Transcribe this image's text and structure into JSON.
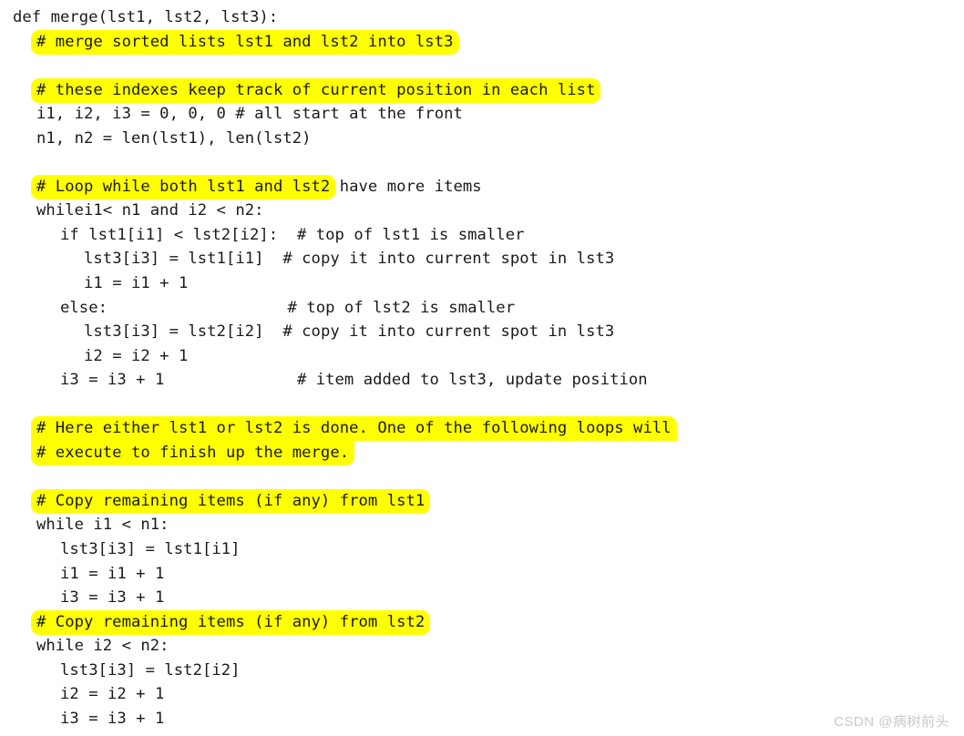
{
  "document": {
    "kind": "python-code-listing",
    "language": "Python",
    "background_color": "#ffffff",
    "text_color": "#1a1a1a",
    "highlight_color": "#ffff00"
  },
  "code": {
    "lines": [
      {
        "id": "l01",
        "indent": 0,
        "segments": [
          {
            "text": "def merge(lst1, lst2, lst3):",
            "highlight": "none"
          }
        ]
      },
      {
        "id": "l02",
        "indent": 1,
        "segments": [
          {
            "text": "# merge sorted lists lst1 and lst2 into lst3",
            "highlight": "full"
          }
        ]
      },
      {
        "id": "l03",
        "indent": 0,
        "blank": true,
        "segments": []
      },
      {
        "id": "l04",
        "indent": 1,
        "segments": [
          {
            "text": "# these indexes keep track of current position in each list",
            "highlight": "full"
          }
        ]
      },
      {
        "id": "l05",
        "indent": 1,
        "segments": [
          {
            "text": "i1, i2, i3 = 0, 0, 0 # all start at the front",
            "highlight": "none"
          }
        ]
      },
      {
        "id": "l06",
        "indent": 1,
        "segments": [
          {
            "text": "n1, n2 = len(lst1), len(lst2)",
            "highlight": "none"
          }
        ]
      },
      {
        "id": "l07",
        "indent": 0,
        "blank": true,
        "segments": []
      },
      {
        "id": "l08",
        "indent": 1,
        "segments": [
          {
            "text": "# Loop while both lst1 and lst2",
            "highlight": "full"
          },
          {
            "text": " have more items",
            "highlight": "none"
          }
        ]
      },
      {
        "id": "l09",
        "indent": 1,
        "segments": [
          {
            "text": "whilei1< n1 and i2 < n2:",
            "highlight": "none"
          }
        ]
      },
      {
        "id": "l10",
        "indent": 2,
        "segments": [
          {
            "text": "if lst1[i1] < lst2[i2]:  # top of lst1 is smaller",
            "highlight": "none"
          }
        ]
      },
      {
        "id": "l11",
        "indent": 3,
        "segments": [
          {
            "text": "lst3[i3] = lst1[i1]  # copy it into current spot in lst3",
            "highlight": "none"
          }
        ]
      },
      {
        "id": "l12",
        "indent": 3,
        "segments": [
          {
            "text": "i1 = i1 + 1",
            "highlight": "none"
          }
        ]
      },
      {
        "id": "l13",
        "indent": 2,
        "segments": [
          {
            "text": "else:                   # top of lst2 is smaller",
            "highlight": "none"
          }
        ]
      },
      {
        "id": "l14",
        "indent": 3,
        "segments": [
          {
            "text": "lst3[i3] = lst2[i2]  # copy it into current spot in lst3",
            "highlight": "none"
          }
        ]
      },
      {
        "id": "l15",
        "indent": 3,
        "segments": [
          {
            "text": "i2 = i2 + 1",
            "highlight": "none"
          }
        ]
      },
      {
        "id": "l16",
        "indent": 2,
        "segments": [
          {
            "text": "i3 = i3 + 1              # item added to lst3, update position",
            "highlight": "none"
          }
        ]
      },
      {
        "id": "l17",
        "indent": 0,
        "blank": true,
        "segments": []
      },
      {
        "id": "l18",
        "indent": 1,
        "segments": [
          {
            "text": "# Here either lst1 or lst2 is done. One of the following loops will",
            "highlight": "top"
          }
        ]
      },
      {
        "id": "l19",
        "indent": 1,
        "segments": [
          {
            "text": "# execute to finish up the merge.",
            "highlight": "bottom"
          }
        ]
      },
      {
        "id": "l20",
        "indent": 0,
        "blank": true,
        "segments": []
      },
      {
        "id": "l21",
        "indent": 1,
        "segments": [
          {
            "text": "# Copy remaining items (if any) from lst1",
            "highlight": "full"
          }
        ]
      },
      {
        "id": "l22",
        "indent": 1,
        "segments": [
          {
            "text": "while i1 < n1:",
            "highlight": "none"
          }
        ]
      },
      {
        "id": "l23",
        "indent": 2,
        "segments": [
          {
            "text": "lst3[i3] = lst1[i1]",
            "highlight": "none"
          }
        ]
      },
      {
        "id": "l24",
        "indent": 2,
        "segments": [
          {
            "text": "i1 = i1 + 1",
            "highlight": "none"
          }
        ]
      },
      {
        "id": "l25",
        "indent": 2,
        "segments": [
          {
            "text": "i3 = i3 + 1",
            "highlight": "none"
          }
        ]
      },
      {
        "id": "l26",
        "indent": 1,
        "segments": [
          {
            "text": "# Copy remaining items (if any) from lst2",
            "highlight": "full"
          }
        ]
      },
      {
        "id": "l27",
        "indent": 1,
        "segments": [
          {
            "text": "while i2 < n2:",
            "highlight": "none"
          }
        ]
      },
      {
        "id": "l28",
        "indent": 2,
        "segments": [
          {
            "text": "lst3[i3] = lst2[i2]",
            "highlight": "none"
          }
        ]
      },
      {
        "id": "l29",
        "indent": 2,
        "segments": [
          {
            "text": "i2 = i2 + 1",
            "highlight": "none"
          }
        ]
      },
      {
        "id": "l30",
        "indent": 2,
        "segments": [
          {
            "text": "i3 = i3 + 1",
            "highlight": "none"
          }
        ]
      }
    ]
  },
  "watermark": {
    "text": "CSDN @病树前头"
  }
}
